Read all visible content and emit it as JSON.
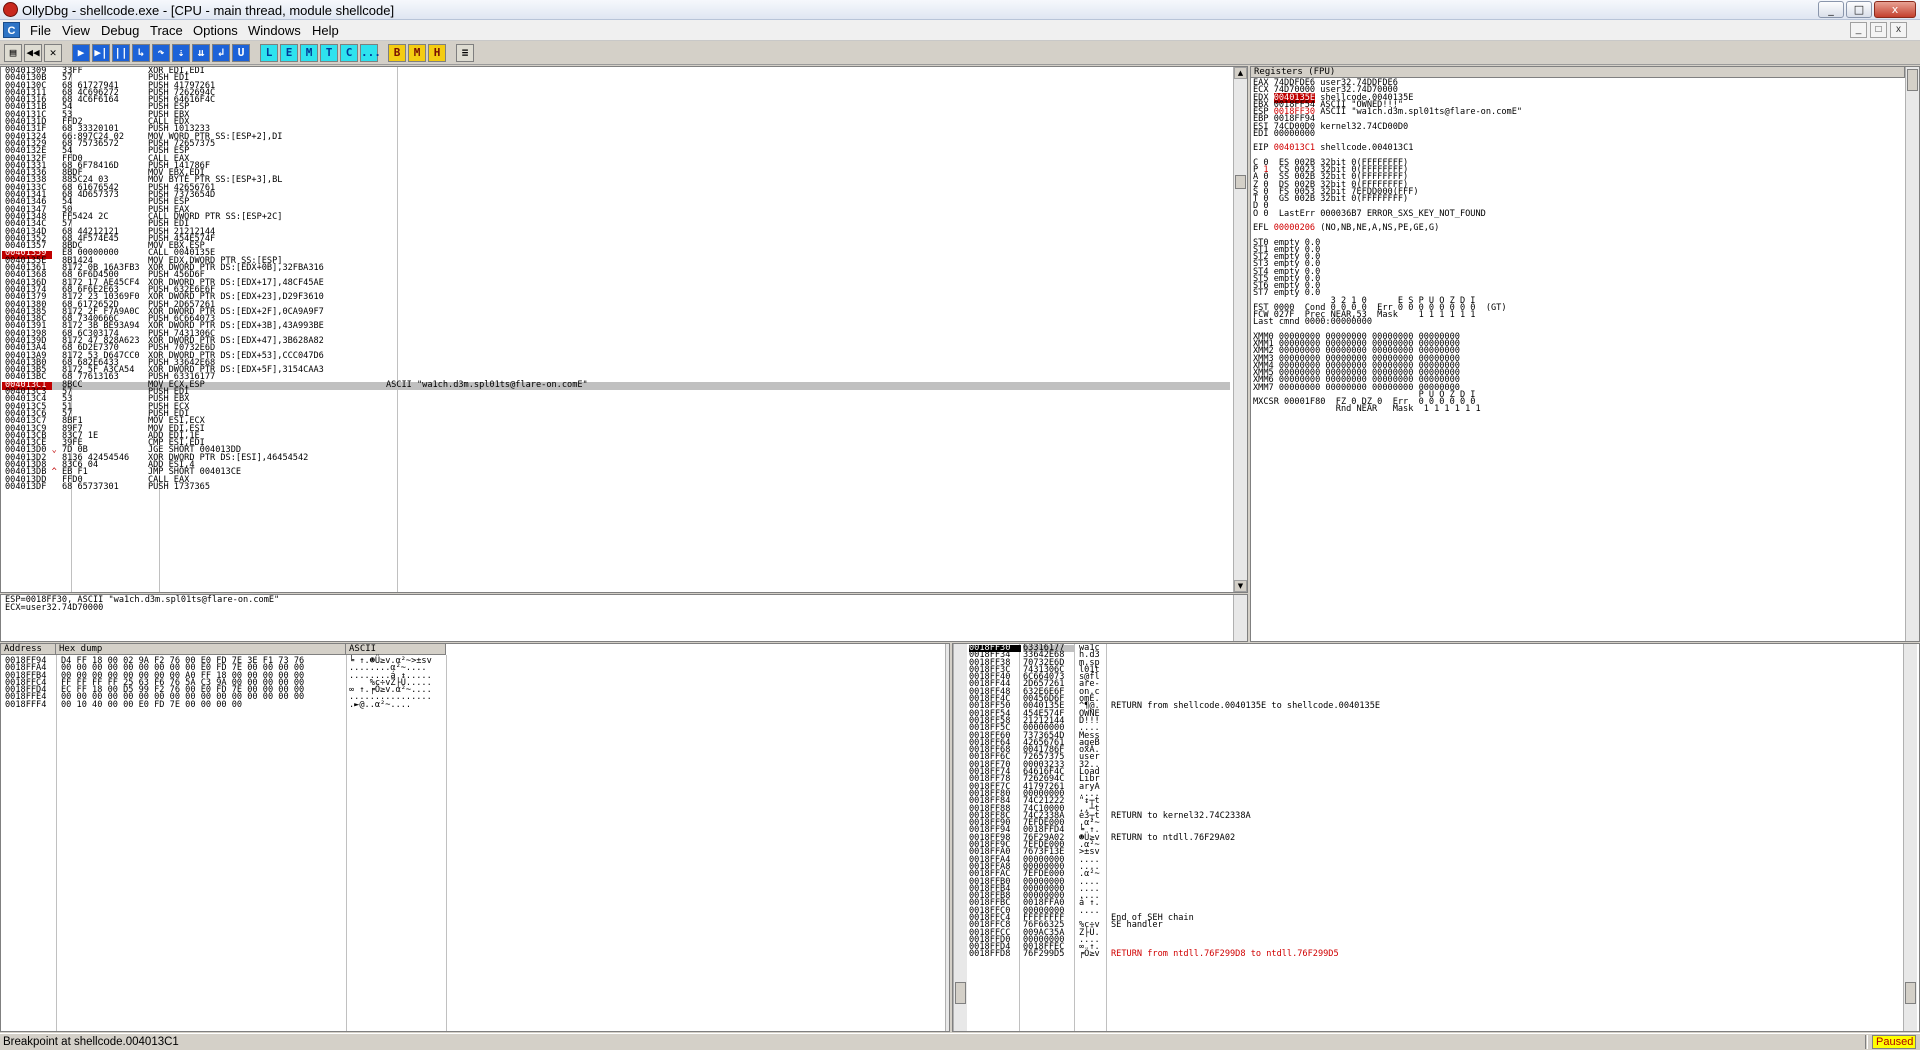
{
  "window": {
    "title": "OllyDbg - shellcode.exe - [CPU - main thread, module shellcode]",
    "buttons": [
      "_",
      "□",
      "x"
    ]
  },
  "menu": {
    "mdi_icon": "C",
    "items": [
      "File",
      "View",
      "Debug",
      "Trace",
      "Options",
      "Windows",
      "Help"
    ],
    "mdi_buttons": [
      "_",
      "□",
      "x"
    ]
  },
  "toolbar": {
    "buttons": [
      {
        "name": "open",
        "label": "▤"
      },
      {
        "name": "restart",
        "label": "◀◀"
      },
      {
        "name": "close",
        "label": "✕"
      },
      {
        "name": "run",
        "label": "▶"
      },
      {
        "name": "run-thread",
        "label": "▶|"
      },
      {
        "name": "pause",
        "label": "||"
      },
      {
        "name": "step-into",
        "label": "↳"
      },
      {
        "name": "step-over",
        "label": "↷"
      },
      {
        "name": "trace-into",
        "label": "⇣"
      },
      {
        "name": "trace-over",
        "label": "⇊"
      },
      {
        "name": "execute-till-return",
        "label": "↲"
      },
      {
        "name": "execute-till-user",
        "label": "U"
      },
      {
        "name": "log",
        "label": "L"
      },
      {
        "name": "executable-modules",
        "label": "E"
      },
      {
        "name": "memory-map",
        "label": "M"
      },
      {
        "name": "threads",
        "label": "T"
      },
      {
        "name": "cpu",
        "label": "C"
      },
      {
        "name": "patches",
        "label": "..."
      },
      {
        "name": "breakpoints",
        "label": "B"
      },
      {
        "name": "memory-bp",
        "label": "M"
      },
      {
        "name": "hardware-bp",
        "label": "H"
      },
      {
        "name": "list",
        "label": "≡"
      }
    ]
  },
  "disasm": {
    "rows": [
      [
        "00401309",
        "33FF",
        "XOR EDI,EDI",
        ""
      ],
      [
        "0040130B",
        "57",
        "PUSH EDI",
        ""
      ],
      [
        "0040130C",
        "68 61727941",
        "PUSH 41797261",
        ""
      ],
      [
        "00401311",
        "68 4C696272",
        "PUSH 7262694C",
        ""
      ],
      [
        "00401316",
        "68 4C6F6164",
        "PUSH 64616F4C",
        ""
      ],
      [
        "0040131B",
        "54",
        "PUSH ESP",
        ""
      ],
      [
        "0040131C",
        "53",
        "PUSH EBX",
        ""
      ],
      [
        "0040131D",
        "FFD2",
        "CALL EDX",
        ""
      ],
      [
        "0040131F",
        "68 33320101",
        "PUSH 1013233",
        ""
      ],
      [
        "00401324",
        "66:897C24 02",
        "MOV WORD PTR SS:[ESP+2],DI",
        ""
      ],
      [
        "00401329",
        "68 75736572",
        "PUSH 72657375",
        ""
      ],
      [
        "0040132E",
        "54",
        "PUSH ESP",
        ""
      ],
      [
        "0040132F",
        "FFD0",
        "CALL EAX",
        ""
      ],
      [
        "00401331",
        "68 6F78416D",
        "PUSH 141786F",
        ""
      ],
      [
        "00401336",
        "8BDF",
        "MOV EBX,EDI",
        ""
      ],
      [
        "00401338",
        "885C24 03",
        "MOV BYTE PTR SS:[ESP+3],BL",
        ""
      ],
      [
        "0040133C",
        "68 61676542",
        "PUSH 42656761",
        ""
      ],
      [
        "00401341",
        "68 4D657373",
        "PUSH 7373654D",
        ""
      ],
      [
        "00401346",
        "54",
        "PUSH ESP",
        ""
      ],
      [
        "00401347",
        "50",
        "PUSH EAX",
        ""
      ],
      [
        "00401348",
        "FF5424 2C",
        "CALL DWORD PTR SS:[ESP+2C]",
        ""
      ],
      [
        "0040134C",
        "57",
        "PUSH EDI",
        ""
      ],
      [
        "0040134D",
        "68 44212121",
        "PUSH 21212144",
        ""
      ],
      [
        "00401352",
        "68 4F574E45",
        "PUSH 454E574F",
        ""
      ],
      [
        "00401357",
        "8BDC",
        "MOV EBX,ESP",
        ""
      ],
      [
        "00401359",
        "E8 00000000",
        "CALL 0040135E",
        ""
      ],
      [
        "0040135E",
        "8B1424",
        "MOV EDX,DWORD PTR SS:[ESP]",
        ""
      ],
      [
        "00401361",
        "8172 0B 16A3FB3",
        "XOR DWORD PTR DS:[EDX+0B],32FBA316",
        ""
      ],
      [
        "00401368",
        "68 6F6D4500",
        "PUSH 456D6F",
        ""
      ],
      [
        "0040136D",
        "8172 17 AE45CF4",
        "XOR DWORD PTR DS:[EDX+17],48CF45AE",
        ""
      ],
      [
        "00401374",
        "68 6F6E2E63",
        "PUSH 632E6E6F",
        ""
      ],
      [
        "00401379",
        "8172 23 10369F0",
        "XOR DWORD PTR DS:[EDX+23],D29F3610",
        ""
      ],
      [
        "00401380",
        "68 6172652D",
        "PUSH 2D657261",
        ""
      ],
      [
        "00401385",
        "8172 2F F7A9A0C",
        "XOR DWORD PTR DS:[EDX+2F],0CA9A9F7",
        ""
      ],
      [
        "0040138C",
        "68 7340666C",
        "PUSH 6C664073",
        ""
      ],
      [
        "00401391",
        "8172 3B BE93A94",
        "XOR DWORD PTR DS:[EDX+3B],43A993BE",
        ""
      ],
      [
        "00401398",
        "68 6C303174",
        "PUSH 7431306C",
        ""
      ],
      [
        "0040139D",
        "8172 47 828A623",
        "XOR DWORD PTR DS:[EDX+47],3B628A82",
        ""
      ],
      [
        "004013A4",
        "68 6D2E7370",
        "PUSH 70732E6D",
        ""
      ],
      [
        "004013A9",
        "8172 53 D647CC0",
        "XOR DWORD PTR DS:[EDX+53],CCC047D6",
        ""
      ],
      [
        "004013B0",
        "68 682E6433",
        "PUSH 33642E68",
        ""
      ],
      [
        "004013B5",
        "8172 5F A3CA54",
        "XOR DWORD PTR DS:[EDX+5F],3154CAA3",
        ""
      ],
      [
        "004013BC",
        "68 77613163",
        "PUSH 63316177",
        ""
      ],
      [
        "004013C1",
        "8BCC",
        "MOV ECX,ESP",
        "ASCII \"wa1ch.d3m.spl01ts@flare-on.comE\""
      ],
      [
        "004013C3",
        "57",
        "PUSH EDI",
        ""
      ],
      [
        "004013C4",
        "53",
        "PUSH EBX",
        ""
      ],
      [
        "004013C5",
        "51",
        "PUSH ECX",
        ""
      ],
      [
        "004013C6",
        "57",
        "PUSH EDI",
        ""
      ],
      [
        "004013C7",
        "8BF1",
        "MOV ESI,ECX",
        ""
      ],
      [
        "004013C9",
        "89F7",
        "MOV EDI,ESI",
        ""
      ],
      [
        "004013CB",
        "83C7 1E",
        "ADD EDI,1E",
        ""
      ],
      [
        "004013CE",
        "39FE",
        "CMP ESI,EDI",
        ""
      ],
      [
        "004013D0",
        "7D 0B",
        "JGE SHORT 004013DD",
        ""
      ],
      [
        "004013D2",
        "8136 42454546",
        "XOR DWORD PTR DS:[ESI],46454542",
        ""
      ],
      [
        "004013D8",
        "83C6 04",
        "ADD ESI,4",
        ""
      ],
      [
        "004013DB",
        "EB F1",
        "JMP SHORT 004013CE",
        ""
      ],
      [
        "004013DD",
        "FFD0",
        "CALL EAX",
        ""
      ],
      [
        "004013DF",
        "68 65737301",
        "PUSH 1737365",
        ""
      ]
    ],
    "breakpoint_row": 25,
    "current_row": 43,
    "jump_marks": {
      "52": "⌄",
      "55": "^"
    }
  },
  "info_pane": {
    "lines": [
      "ESP=0018FF30, ASCII \"wa1ch.d3m.spl01ts@flare-on.comE\"",
      "ECX=user32.74D70000"
    ]
  },
  "registers": {
    "header": "Registers (FPU)",
    "lines": [
      {
        "text": "EAX 74DDFDE6 user32.74DDFDE6",
        "red": ""
      },
      {
        "text": "ECX 74D70000 user32.74D70000",
        "red": ""
      },
      {
        "text": "EDX 0040135E shellcode.0040135E",
        "red": "0040135E"
      },
      {
        "text": "EBX 0018FF54 ASCII \"OWNED!!!\"",
        "red": ""
      },
      {
        "text": "ESP 0018FF30 ASCII \"wa1ch.d3m.spl01ts@flare-on.comE\"",
        "red": "0018FF30"
      },
      {
        "text": "EBP 0018FF94",
        "red": ""
      },
      {
        "text": "ESI 74CD00D0 kernel32.74CD00D0",
        "red": ""
      },
      {
        "text": "EDI 00000000",
        "red": ""
      },
      {
        "text": "",
        "red": ""
      },
      {
        "text": "EIP 004013C1 shellcode.004013C1",
        "red": "004013C1"
      },
      {
        "text": "",
        "red": ""
      },
      {
        "text": "C 0  ES 002B 32bit 0(FFFFFFFF)",
        "red": ""
      },
      {
        "text": "P 1  CS 0023 32bit 0(FFFFFFFF)",
        "red": "1"
      },
      {
        "text": "A 0  SS 002B 32bit 0(FFFFFFFF)",
        "red": ""
      },
      {
        "text": "Z 0  DS 002B 32bit 0(FFFFFFFF)",
        "red": ""
      },
      {
        "text": "S 0  FS 0053 32bit 7EFDD000(FFF)",
        "red": ""
      },
      {
        "text": "T 0  GS 002B 32bit 0(FFFFFFFF)",
        "red": ""
      },
      {
        "text": "D 0",
        "red": ""
      },
      {
        "text": "O 0  LastErr 000036B7 ERROR_SXS_KEY_NOT_FOUND",
        "red": ""
      },
      {
        "text": "",
        "red": ""
      },
      {
        "text": "EFL 00000206 (NO,NB,NE,A,NS,PE,GE,G)",
        "red": "00000206"
      },
      {
        "text": "",
        "red": ""
      },
      {
        "text": "ST0 empty 0.0",
        "red": ""
      },
      {
        "text": "ST1 empty 0.0",
        "red": ""
      },
      {
        "text": "ST2 empty 0.0",
        "red": ""
      },
      {
        "text": "ST3 empty 0.0",
        "red": ""
      },
      {
        "text": "ST4 empty 0.0",
        "red": ""
      },
      {
        "text": "ST5 empty 0.0",
        "red": ""
      },
      {
        "text": "ST6 empty 0.0",
        "red": ""
      },
      {
        "text": "ST7 empty 0.0",
        "red": ""
      },
      {
        "text": "               3 2 1 0      E S P U O Z D I",
        "red": ""
      },
      {
        "text": "FST 0000  Cond 0 0 0 0  Err 0 0 0 0 0 0 0 0  (GT)",
        "red": ""
      },
      {
        "text": "FCW 027F  Prec NEAR,53  Mask    1 1 1 1 1 1",
        "red": ""
      },
      {
        "text": "Last cmnd 0000:00000000",
        "red": ""
      },
      {
        "text": "",
        "red": ""
      },
      {
        "text": "XMM0 00000000 00000000 00000000 00000000",
        "red": ""
      },
      {
        "text": "XMM1 00000000 00000000 00000000 00000000",
        "red": ""
      },
      {
        "text": "XMM2 00000000 00000000 00000000 00000000",
        "red": ""
      },
      {
        "text": "XMM3 00000000 00000000 00000000 00000000",
        "red": ""
      },
      {
        "text": "XMM4 00000000 00000000 00000000 00000000",
        "red": ""
      },
      {
        "text": "XMM5 00000000 00000000 00000000 00000000",
        "red": ""
      },
      {
        "text": "XMM6 00000000 00000000 00000000 00000000",
        "red": ""
      },
      {
        "text": "XMM7 00000000 00000000 00000000 00000000",
        "red": ""
      },
      {
        "text": "                                P U O Z D I",
        "red": ""
      },
      {
        "text": "MXCSR 00001F80  FZ 0 DZ 0  Err  0 0 0 0 0 0",
        "red": ""
      },
      {
        "text": "                Rnd NEAR   Mask  1 1 1 1 1 1",
        "red": ""
      }
    ]
  },
  "dump": {
    "headers": [
      "Address",
      "Hex dump",
      "ASCII"
    ],
    "rows": [
      [
        "0018FF94",
        "D4 FF 18 00 02 9A F2 76 00 E0 FD 7E 3E F1 73 76",
        "╘ ↑.☻Ü≥v.α²~>±sv"
      ],
      [
        "0018FFA4",
        "00 00 00 00 00 00 00 00 00 E0 FD 7E 00 00 00 00",
        "........α²~...."
      ],
      [
        "0018FFB4",
        "00 00 00 00 00 00 00 00 A0 FF 18 00 00 00 00 00",
        "........á ↑....."
      ],
      [
        "0018FFC4",
        "FF FF FF FF 25 63 F6 76 5A C3 9A 00 00 00 00 00",
        "    %c÷vZ├Ü....."
      ],
      [
        "0018FFD4",
        "EC FF 18 00 D5 99 F2 76 00 E0 FD 7E 00 00 00 00",
        "∞ ↑.╒Ö≥v.α²~...."
      ],
      [
        "0018FFE4",
        "00 00 00 00 00 00 00 00 00 00 00 00 00 00 00 00",
        "................"
      ],
      [
        "0018FFF4",
        "00 10 40 00 00 E0 FD 7E 00 00 00 00",
        ".►@..α²~...."
      ]
    ]
  },
  "stack": {
    "top_address": "0018FF30",
    "top_value": "63316177",
    "top_ascii": "wa1c",
    "rows": [
      [
        "0018FF34",
        "33642E68",
        "h.d3",
        ""
      ],
      [
        "0018FF38",
        "70732E6D",
        "m.sp",
        ""
      ],
      [
        "0018FF3C",
        "7431306C",
        "l01t",
        ""
      ],
      [
        "0018FF40",
        "6C664073",
        "s@fl",
        ""
      ],
      [
        "0018FF44",
        "2D657261",
        "are-",
        ""
      ],
      [
        "0018FF48",
        "632E6E6F",
        "on.c",
        ""
      ],
      [
        "0018FF4C",
        "00456D6F",
        "omE.",
        ""
      ],
      [
        "0018FF50",
        "0040135E",
        "^¶@.",
        "RETURN from shellcode.0040135E to shellcode.0040135E"
      ],
      [
        "0018FF54",
        "454E574F",
        "OWNE",
        ""
      ],
      [
        "0018FF58",
        "21212144",
        "D!!!",
        ""
      ],
      [
        "0018FF5C",
        "00000000",
        "....",
        ""
      ],
      [
        "0018FF60",
        "7373654D",
        "Mess",
        ""
      ],
      [
        "0018FF64",
        "42656761",
        "ageB",
        ""
      ],
      [
        "0018FF68",
        "0041786F",
        "oxA.",
        ""
      ],
      [
        "0018FF6C",
        "72657375",
        "user",
        ""
      ],
      [
        "0018FF70",
        "00003233",
        "32..",
        ""
      ],
      [
        "0018FF74",
        "64616F4C",
        "Load",
        ""
      ],
      [
        "0018FF78",
        "7262694C",
        "Libr",
        ""
      ],
      [
        "0018FF7C",
        "41797261",
        "aryA",
        ""
      ],
      [
        "0018FF80",
        "00000000",
        "....",
        ""
      ],
      [
        "0018FF84",
        "74C21222",
        "\"↕┬t",
        ""
      ],
      [
        "0018FF88",
        "74C10000",
        "..┴t",
        ""
      ],
      [
        "0018FF8C",
        "74C2338A",
        "è3┬t",
        "RETURN to kernel32.74C2338A"
      ],
      [
        "0018FF90",
        "7EFDE000",
        ".α²~",
        ""
      ],
      [
        "0018FF94",
        "0018FFD4",
        "╘ ↑.",
        ""
      ],
      [
        "0018FF98",
        "76F29A02",
        "☻Ü≥v",
        "RETURN to ntdll.76F29A02"
      ],
      [
        "0018FF9C",
        "7EFDE000",
        ".α²~",
        ""
      ],
      [
        "0018FFA0",
        "7673F13E",
        ">±sv",
        ""
      ],
      [
        "0018FFA4",
        "00000000",
        "....",
        ""
      ],
      [
        "0018FFA8",
        "00000000",
        "....",
        ""
      ],
      [
        "0018FFAC",
        "7EFDE000",
        ".α²~",
        ""
      ],
      [
        "0018FFB0",
        "00000000",
        "....",
        ""
      ],
      [
        "0018FFB4",
        "00000000",
        "....",
        ""
      ],
      [
        "0018FFB8",
        "00000000",
        "....",
        ""
      ],
      [
        "0018FFBC",
        "0018FFA0",
        "á ↑.",
        ""
      ],
      [
        "0018FFC0",
        "00000000",
        "....",
        ""
      ],
      [
        "0018FFC4",
        "FFFFFFFF",
        "    ",
        "End of SEH chain"
      ],
      [
        "0018FFC8",
        "76F66325",
        "%c÷v",
        "SE handler"
      ],
      [
        "0018FFCC",
        "009AC35A",
        "Z├Ü.",
        ""
      ],
      [
        "0018FFD0",
        "00000000",
        "....",
        ""
      ],
      [
        "0018FFD4",
        "0018FFEC",
        "∞ ↑.",
        ""
      ],
      [
        "0018FFD8",
        "76F299D5",
        "╒Ö≥v",
        "RETURN from ntdll.76F299D8 to ntdll.76F299D5"
      ]
    ],
    "red_rows": [
      24,
      41
    ]
  },
  "status": {
    "message": "Breakpoint at shellcode.004013C1",
    "state": "Paused"
  },
  "colors": {
    "breakpoint": "#c00000",
    "selection": "#c0c0c0",
    "paused_bg": "#ffff00",
    "paused_fg": "#b00000"
  }
}
